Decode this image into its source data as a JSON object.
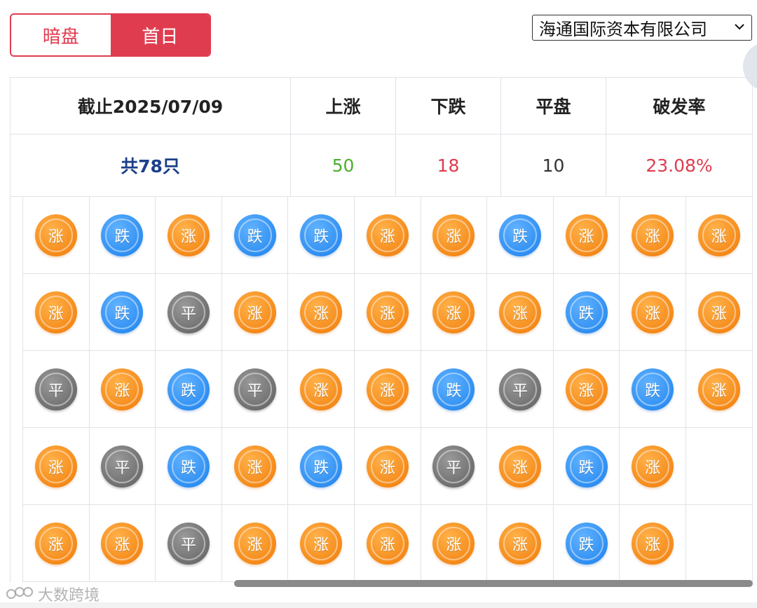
{
  "tabs": [
    {
      "label": "暗盘",
      "active": false
    },
    {
      "label": "首日",
      "active": true
    }
  ],
  "broker_select": {
    "value": "海通国际资本有限公司"
  },
  "summary": {
    "date_label": "截止2025/07/09",
    "headers": {
      "up": "上涨",
      "down": "下跌",
      "flat": "平盘",
      "break_rate": "破发率"
    },
    "total": "共78只",
    "up": "50",
    "down": "18",
    "flat": "10",
    "break_rate": "23.08%"
  },
  "legend": {
    "up": "涨",
    "down": "跌",
    "flat": "平"
  },
  "colors": {
    "accent": "#e03c4f",
    "up_text": "#4cae2f",
    "down_text": "#e03c4f",
    "coin_up": "#f58a1a",
    "coin_down": "#2f8ff2",
    "coin_flat": "#6f6f6f"
  },
  "grid": [
    [
      "up",
      "down",
      "up",
      "down",
      "down",
      "up",
      "up",
      "down",
      "up",
      "up",
      "up"
    ],
    [
      "up",
      "down",
      "flat",
      "up",
      "up",
      "up",
      "up",
      "up",
      "down",
      "up",
      "up"
    ],
    [
      "flat",
      "up",
      "down",
      "flat",
      "up",
      "up",
      "down",
      "flat",
      "up",
      "down",
      "up"
    ],
    [
      "up",
      "flat",
      "down",
      "up",
      "down",
      "up",
      "flat",
      "up",
      "down",
      "up",
      ""
    ],
    [
      "up",
      "up",
      "flat",
      "up",
      "up",
      "up",
      "up",
      "up",
      "down",
      "up",
      ""
    ]
  ],
  "watermark": "大数跨境"
}
